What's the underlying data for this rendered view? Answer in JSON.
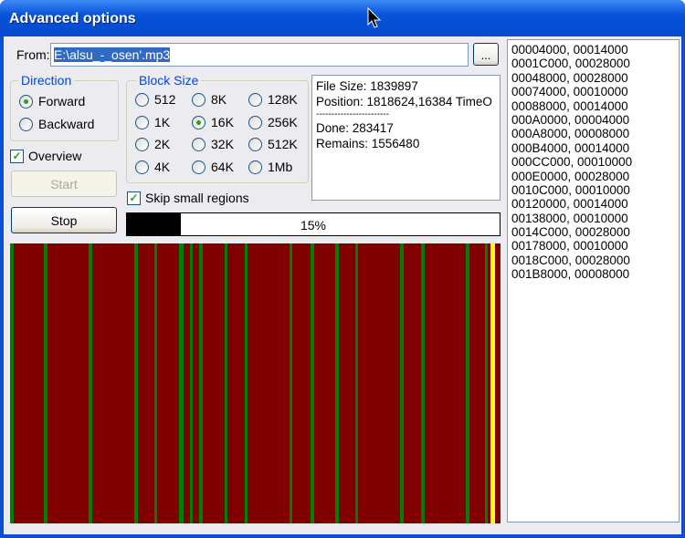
{
  "window": {
    "title": "Advanced options"
  },
  "from": {
    "label": "From:",
    "value": "E:\\alsu_-_osen'.mp3",
    "browse_label": "..."
  },
  "direction": {
    "legend": "Direction",
    "options": [
      {
        "label": "Forward",
        "checked": true
      },
      {
        "label": "Backward",
        "checked": false
      }
    ]
  },
  "block_size": {
    "legend": "Block Size",
    "options": [
      {
        "label": "512",
        "checked": false
      },
      {
        "label": "8K",
        "checked": false
      },
      {
        "label": "128K",
        "checked": false
      },
      {
        "label": "1K",
        "checked": false
      },
      {
        "label": "16K",
        "checked": true
      },
      {
        "label": "256K",
        "checked": false
      },
      {
        "label": "2K",
        "checked": false
      },
      {
        "label": "32K",
        "checked": false
      },
      {
        "label": "512K",
        "checked": false
      },
      {
        "label": "4K",
        "checked": false
      },
      {
        "label": "64K",
        "checked": false
      },
      {
        "label": "1Mb",
        "checked": false
      }
    ]
  },
  "overview": {
    "label": "Overview",
    "checked": true
  },
  "skip_small": {
    "label": "Skip small regions",
    "checked": true
  },
  "buttons": {
    "start": "Start",
    "stop": "Stop"
  },
  "info": {
    "lines": [
      "File Size: 1839897",
      "Position: 1818624,16384 TimeO",
      "------------------------",
      "Done: 283417",
      "Remains: 1556480"
    ]
  },
  "progress": {
    "percent": 15,
    "label": "15%"
  },
  "regions": [
    "00004000, 00014000",
    "0001C000, 00028000",
    "00048000, 00028000",
    "00074000, 00010000",
    "00088000, 00014000",
    "000A0000, 00004000",
    "000A8000, 00008000",
    "000B4000, 00014000",
    "000CC000, 00010000",
    "000E0000, 00028000",
    "0010C000, 00010000",
    "00120000, 00014000",
    "00138000, 00010000",
    "0014C000, 00028000",
    "00178000, 00010000",
    "0018C000, 00028000",
    "001B8000, 00008000"
  ],
  "colors": {
    "bad": "#800000",
    "good": "#008000",
    "current": "#ffff00"
  }
}
